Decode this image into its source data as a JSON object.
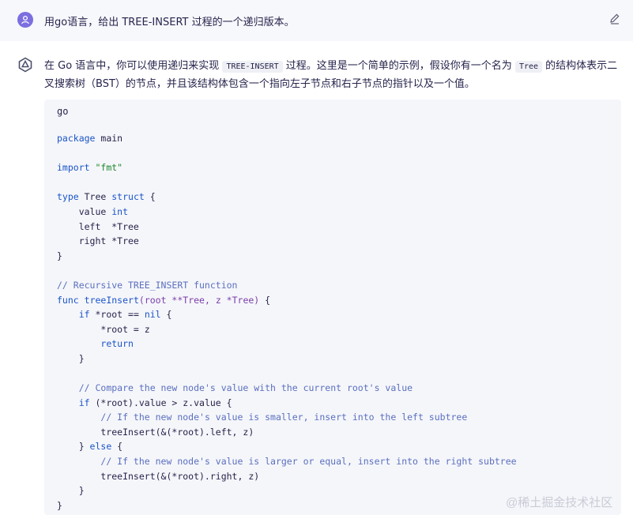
{
  "user": {
    "message": "用go语言，给出 TREE-INSERT 过程的一个递归版本。",
    "avatar_icon": "user-icon",
    "edit_icon": "pencil-icon"
  },
  "assistant": {
    "avatar_icon": "ai-logo-icon",
    "intro_parts": [
      "在 Go 语言中，你可以使用递归来实现 ",
      "TREE-INSERT",
      " 过程。这里是一个简单的示例，假设你有一个名为 ",
      "Tree",
      " 的结构体表示二叉搜索树（BST）的节点，并且该结构体包含一个指向左子节点和右子节点的指针以及一个值。"
    ],
    "code": {
      "language": "go",
      "lines": [
        [
          [
            "kw",
            "package"
          ],
          [
            "plain",
            " main"
          ]
        ],
        [],
        [
          [
            "kw",
            "import"
          ],
          [
            "plain",
            " "
          ],
          [
            "str",
            "\"fmt\""
          ]
        ],
        [],
        [
          [
            "kw",
            "type"
          ],
          [
            "plain",
            " Tree "
          ],
          [
            "kw",
            "struct"
          ],
          [
            "plain",
            " {"
          ]
        ],
        [
          [
            "plain",
            "    value "
          ],
          [
            "kw",
            "int"
          ]
        ],
        [
          [
            "plain",
            "    left  *Tree"
          ]
        ],
        [
          [
            "plain",
            "    right *Tree"
          ]
        ],
        [
          [
            "plain",
            "}"
          ]
        ],
        [],
        [
          [
            "cm",
            "// Recursive TREE_INSERT function"
          ]
        ],
        [
          [
            "kw",
            "func"
          ],
          [
            "plain",
            " "
          ],
          [
            "fn",
            "treeInsert"
          ],
          [
            "type",
            "(root **Tree, z *Tree)"
          ],
          [
            "plain",
            " {"
          ]
        ],
        [
          [
            "plain",
            "    "
          ],
          [
            "kw",
            "if"
          ],
          [
            "plain",
            " *root == "
          ],
          [
            "kw",
            "nil"
          ],
          [
            "plain",
            " {"
          ]
        ],
        [
          [
            "plain",
            "        *root = z"
          ]
        ],
        [
          [
            "plain",
            "        "
          ],
          [
            "kw",
            "return"
          ]
        ],
        [
          [
            "plain",
            "    }"
          ]
        ],
        [],
        [
          [
            "plain",
            "    "
          ],
          [
            "cm",
            "// Compare the new node's value with the current root's value"
          ]
        ],
        [
          [
            "plain",
            "    "
          ],
          [
            "kw",
            "if"
          ],
          [
            "plain",
            " (*root).value > z.value {"
          ]
        ],
        [
          [
            "plain",
            "        "
          ],
          [
            "cm",
            "// If the new node's value is smaller, insert into the left subtree"
          ]
        ],
        [
          [
            "plain",
            "        treeInsert(&(*root).left, z)"
          ]
        ],
        [
          [
            "plain",
            "    } "
          ],
          [
            "kw",
            "else"
          ],
          [
            "plain",
            " {"
          ]
        ],
        [
          [
            "plain",
            "        "
          ],
          [
            "cm",
            "// If the new node's value is larger or equal, insert into the right subtree"
          ]
        ],
        [
          [
            "plain",
            "        treeInsert(&(*root).right, z)"
          ]
        ],
        [
          [
            "plain",
            "    }"
          ]
        ],
        [
          [
            "plain",
            "}"
          ]
        ]
      ]
    }
  },
  "watermark": "@稀土掘金技术社区"
}
